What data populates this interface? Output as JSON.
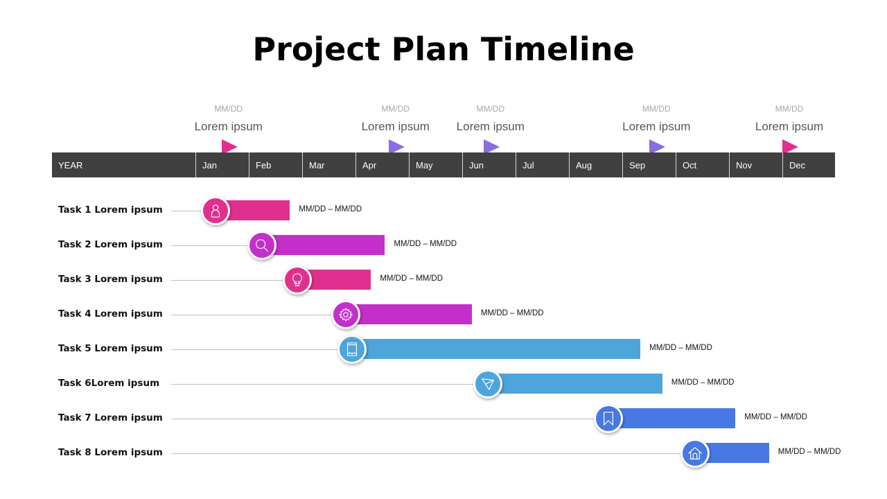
{
  "title": "Project Plan Timeline",
  "colors": {
    "header_bg": "#404040",
    "pink": "#e0308f",
    "purple": "#c42fcc",
    "sky_blue": "#4ea5dc",
    "royal_blue": "#4878e4",
    "flag_purple": "#8a6de0",
    "connector": "#bfbfbf"
  },
  "header": {
    "year_label": "YEAR",
    "months": [
      "Jan",
      "Feb",
      "Mar",
      "Apr",
      "May",
      "Jun",
      "Jul",
      "Aug",
      "Sep",
      "Oct",
      "Nov",
      "Dec"
    ]
  },
  "milestones": [
    {
      "date": "MM/DD",
      "label": "Lorem ipsum",
      "month_pos": 0.49,
      "color": "#e0308f"
    },
    {
      "date": "MM/DD",
      "label": "Lorem ipsum",
      "month_pos": 3.62,
      "color": "#8a6de0"
    },
    {
      "date": "MM/DD",
      "label": "Lorem ipsum",
      "month_pos": 5.4,
      "color": "#8a6de0"
    },
    {
      "date": "MM/DD",
      "label": "Lorem ipsum",
      "month_pos": 8.51,
      "color": "#8a6de0"
    },
    {
      "date": "MM/DD",
      "label": "Lorem ipsum",
      "month_pos": 11.0,
      "color": "#e0308f"
    }
  ],
  "chart_data": {
    "type": "gantt",
    "title": "Project Plan Timeline",
    "x_axis": {
      "categories": [
        "Jan",
        "Feb",
        "Mar",
        "Apr",
        "May",
        "Jun",
        "Jul",
        "Aug",
        "Sep",
        "Oct",
        "Nov",
        "Dec"
      ],
      "range_months": [
        0,
        12
      ],
      "header_label": "YEAR"
    },
    "tasks": [
      {
        "name": "Task 1 Lorem ipsum",
        "start": 0.38,
        "end": 1.77,
        "range_label": "MM/DD – MM/DD",
        "icon": "user-icon",
        "color": "#e0308f"
      },
      {
        "name": "Task 2 Lorem ipsum",
        "start": 1.25,
        "end": 3.55,
        "range_label": "MM/DD – MM/DD",
        "icon": "search-icon",
        "color": "#c42fcc"
      },
      {
        "name": "Task 3 Lorem ipsum",
        "start": 1.91,
        "end": 3.29,
        "range_label": "MM/DD – MM/DD",
        "icon": "lightbulb-icon",
        "color": "#e0308f"
      },
      {
        "name": "Task 4 Lorem ipsum",
        "start": 2.82,
        "end": 5.18,
        "range_label": "MM/DD – MM/DD",
        "icon": "gear-icon",
        "color": "#c42fcc"
      },
      {
        "name": "Task 5 Lorem ipsum",
        "start": 2.94,
        "end": 8.34,
        "range_label": "MM/DD – MM/DD",
        "icon": "tablet-icon",
        "color": "#4ea5dc"
      },
      {
        "name": "Task 6Lorem ipsum",
        "start": 5.48,
        "end": 8.75,
        "range_label": "MM/DD – MM/DD",
        "icon": "send-icon",
        "color": "#4ea5dc"
      },
      {
        "name": "Task 7 Lorem ipsum",
        "start": 7.74,
        "end": 10.12,
        "range_label": "MM/DD – MM/DD",
        "icon": "bookmark-icon",
        "color": "#4878e4"
      },
      {
        "name": "Task 8 Lorem ipsum",
        "start": 9.36,
        "end": 10.75,
        "range_label": "MM/DD – MM/DD",
        "icon": "home-icon",
        "color": "#4878e4"
      }
    ],
    "milestones": [
      {
        "label": "Lorem ipsum",
        "date": "MM/DD",
        "month_pos": 0.49
      },
      {
        "label": "Lorem ipsum",
        "date": "MM/DD",
        "month_pos": 3.62
      },
      {
        "label": "Lorem ipsum",
        "date": "MM/DD",
        "month_pos": 5.4
      },
      {
        "label": "Lorem ipsum",
        "date": "MM/DD",
        "month_pos": 8.51
      },
      {
        "label": "Lorem ipsum",
        "date": "MM/DD",
        "month_pos": 11.0
      }
    ]
  }
}
